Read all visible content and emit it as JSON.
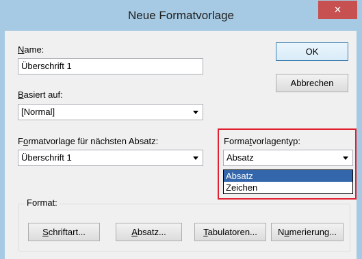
{
  "dialog": {
    "title": "Neue Formatvorlage",
    "close_glyph": "×"
  },
  "name": {
    "label_accel": "N",
    "label_rest": "ame:",
    "value": "Überschrift 1"
  },
  "based_on": {
    "label_accel": "B",
    "label_rest": "asiert auf:",
    "value": "[Normal]"
  },
  "next_style": {
    "label_pre": "F",
    "label_accel": "o",
    "label_rest": "rmatvorlage für nächsten Absatz:",
    "value": "Überschrift 1"
  },
  "style_type": {
    "label_pre": "Forma",
    "label_accel": "t",
    "label_rest": "vorlagentyp:",
    "value": "Absatz",
    "options": [
      "Absatz",
      "Zeichen"
    ],
    "selected_index": 0
  },
  "buttons": {
    "ok": "OK",
    "cancel": "Abbrechen"
  },
  "format_group": {
    "label": "Format:",
    "font_accel": "S",
    "font_rest": "chriftart...",
    "para_accel": "A",
    "para_rest": "bsatz...",
    "tabs_accel": "T",
    "tabs_rest": "abulatoren...",
    "num_pre": "N",
    "num_accel": "u",
    "num_rest": "merierung..."
  },
  "colors": {
    "titlebar": "#a6cae3",
    "close_button": "#c75050",
    "highlight_border": "#e0202e",
    "selection": "#3366aa"
  }
}
